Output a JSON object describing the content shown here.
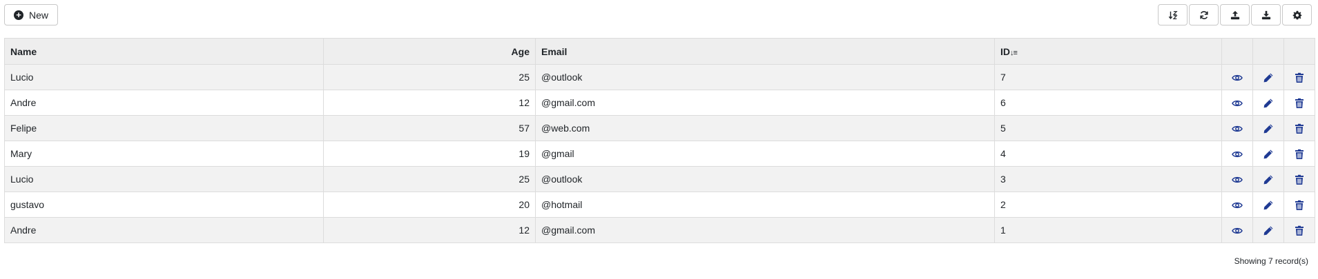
{
  "toolbar": {
    "new_label": "New",
    "tools": [
      {
        "icon": "sort-az-icon"
      },
      {
        "icon": "refresh-icon"
      },
      {
        "icon": "upload-icon"
      },
      {
        "icon": "download-icon"
      },
      {
        "icon": "gear-icon"
      }
    ]
  },
  "table": {
    "headers": {
      "name": "Name",
      "age": "Age",
      "email": "Email",
      "id": "ID"
    },
    "rows": [
      {
        "name": "Lucio",
        "age": "25",
        "email": "@outlook",
        "id": "7"
      },
      {
        "name": "Andre",
        "age": "12",
        "email": "@gmail.com",
        "id": "6"
      },
      {
        "name": "Felipe",
        "age": "57",
        "email": "@web.com",
        "id": "5"
      },
      {
        "name": "Mary",
        "age": "19",
        "email": "@gmail",
        "id": "4"
      },
      {
        "name": "Lucio",
        "age": "25",
        "email": "@outlook",
        "id": "3"
      },
      {
        "name": "gustavo",
        "age": "20",
        "email": "@hotmail",
        "id": "2"
      },
      {
        "name": "Andre",
        "age": "12",
        "email": "@gmail.com",
        "id": "1"
      }
    ]
  },
  "footer": {
    "record_count": "Showing 7 record(s)"
  },
  "colors": {
    "action_icon": "#1f3a93",
    "header_bg": "#eeeeee",
    "stripe_bg": "#f2f2f2"
  }
}
